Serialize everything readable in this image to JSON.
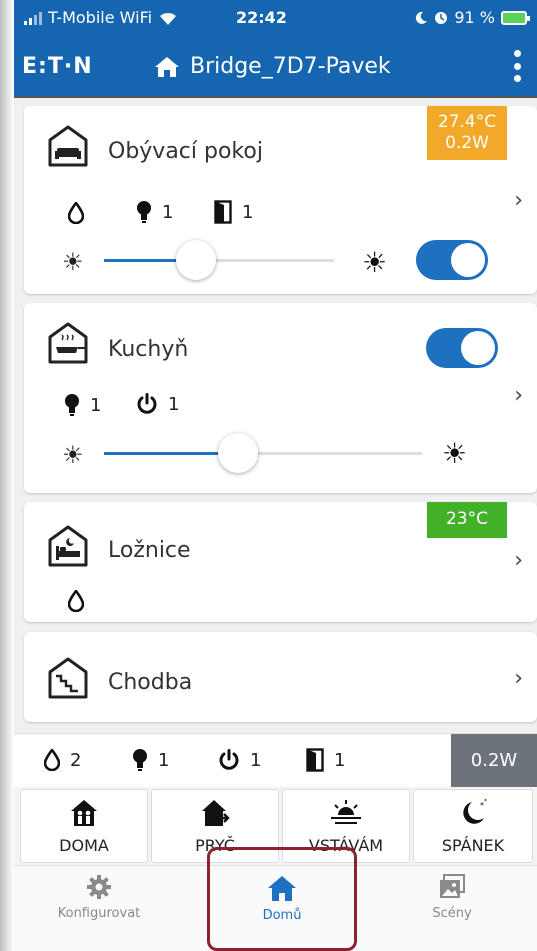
{
  "status_bar": {
    "carrier": "T-Mobile WiFi",
    "time": "22:42",
    "battery": "91 %"
  },
  "app_bar": {
    "logo": "E:T·N",
    "title": "Bridge_7D7-Pavek"
  },
  "rooms": [
    {
      "name": "Obývací pokoj",
      "badge_temp": "27.4°C",
      "badge_power": "0.2W",
      "badge_color": "#f2a829",
      "indicators": {
        "lights": "1",
        "windows": "1"
      },
      "slider_level_pct": 40,
      "switch_on": true
    },
    {
      "name": "Kuchyň",
      "indicators": {
        "lights": "1",
        "sockets": "1"
      },
      "slider_level_pct": 42,
      "switch_on": true
    },
    {
      "name": "Ložnice",
      "badge_temp": "23°C",
      "badge_color": "#43b02a"
    },
    {
      "name": "Chodba"
    }
  ],
  "summary": {
    "water": "2",
    "lights": "1",
    "sockets": "1",
    "windows": "1",
    "power": "0.2W",
    "power_badge_color": "#6d737a"
  },
  "scenes": [
    {
      "label": "DOMA",
      "icon": "home-people-icon"
    },
    {
      "label": "PRYČ",
      "icon": "home-leave-icon"
    },
    {
      "label": "VSTÁVÁM",
      "icon": "sunrise-icon"
    },
    {
      "label": "SPÁNEK",
      "icon": "moon-stars-icon"
    }
  ],
  "bottom_nav": [
    {
      "label": "Konfigurovat",
      "icon": "gear-icon"
    },
    {
      "label": "Domů",
      "icon": "home-icon",
      "active": true
    },
    {
      "label": "Scény",
      "icon": "pictures-icon"
    }
  ],
  "colors": {
    "primary": "#1565b0",
    "accent": "#1e70c0",
    "highlight": "#8a2331"
  }
}
